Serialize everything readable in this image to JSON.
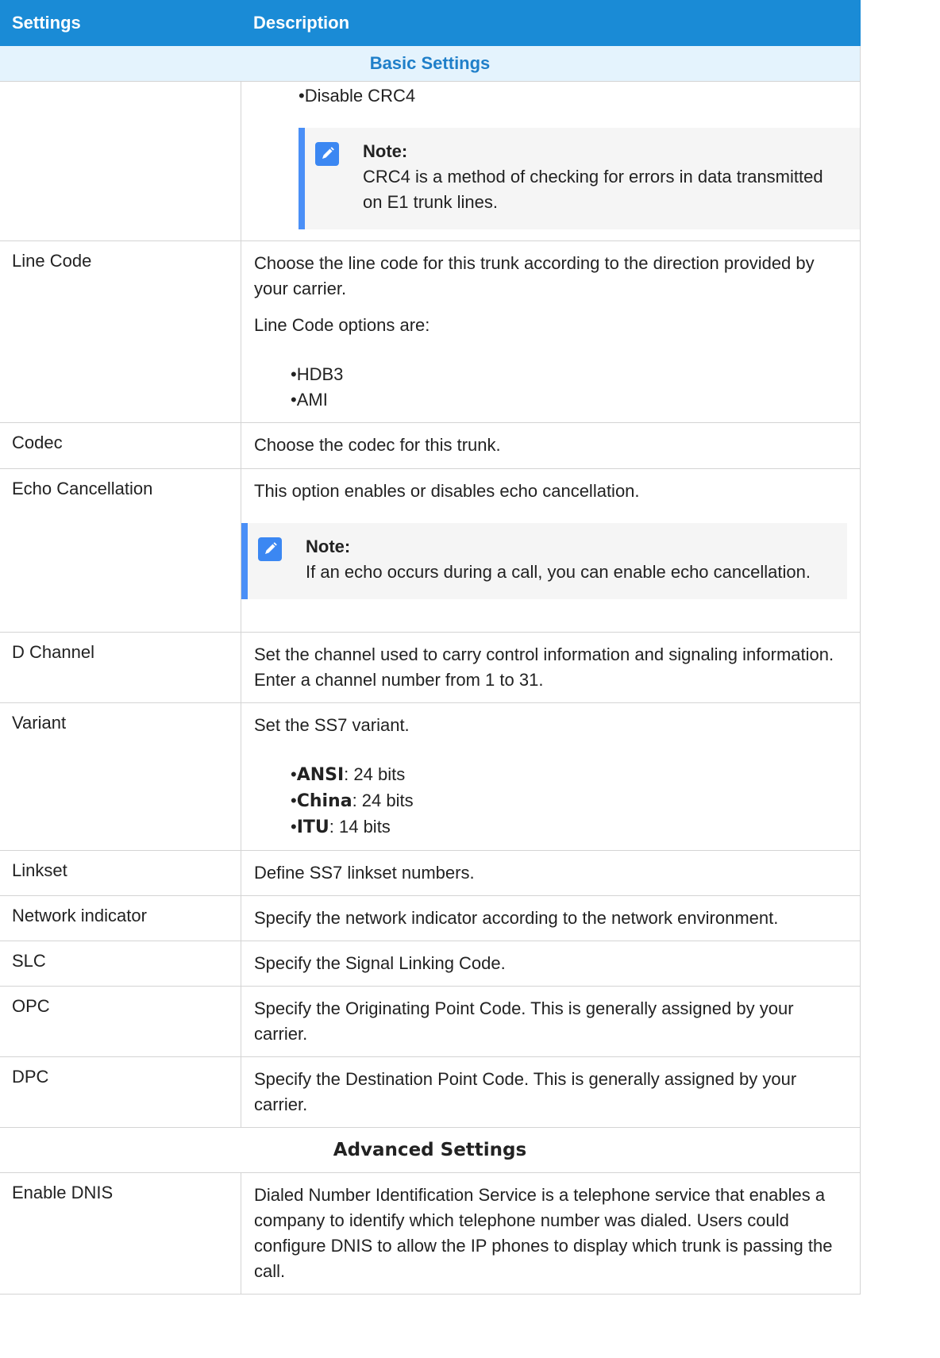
{
  "header": {
    "settings": "Settings",
    "description": "Description"
  },
  "sections": {
    "basic": "Basic Settings",
    "advanced": "Advanced Settings"
  },
  "crc": {
    "item": "Disable CRC4",
    "note_title": "Note:",
    "note_text": "CRC4 is a method of checking for errors in data transmitted on E1 trunk lines."
  },
  "line_code": {
    "name": "Line Code",
    "desc": "Choose the line code for this trunk according to the direction provided by your carrier.",
    "options_intro": "Line Code options are:",
    "options": [
      "HDB3",
      "AMI"
    ]
  },
  "codec": {
    "name": "Codec",
    "desc": "Choose the codec for this trunk."
  },
  "echo": {
    "name": "Echo Cancellation",
    "desc": "This option enables or disables echo cancellation.",
    "note_title": "Note:",
    "note_text": "If an echo occurs during a call, you can enable echo cancellation."
  },
  "d_channel": {
    "name": "D Channel",
    "desc": "Set the channel used to carry control information and signaling information. Enter a channel number from 1 to 31."
  },
  "variant": {
    "name": "Variant",
    "desc": "Set the SS7 variant.",
    "items": [
      {
        "key": "ANSI",
        "value": ": 24 bits"
      },
      {
        "key": "China",
        "value": ": 24 bits"
      },
      {
        "key": "ITU",
        "value": ": 14 bits"
      }
    ]
  },
  "linkset": {
    "name": "Linkset",
    "desc": "Define SS7 linkset numbers."
  },
  "network_indicator": {
    "name": "Network indicator",
    "desc": "Specify the network indicator according to the network environment."
  },
  "slc": {
    "name": "SLC",
    "desc": "Specify the Signal Linking Code."
  },
  "opc": {
    "name": "OPC",
    "desc": "Specify the Originating Point Code. This is generally assigned by your carrier."
  },
  "dpc": {
    "name": "DPC",
    "desc": "Specify the Destination Point Code. This is generally assigned by your carrier."
  },
  "dnis": {
    "name": "Enable DNIS",
    "desc": "Dialed Number Identification Service is a telephone service that enables a company to identify which telephone number was dialed. Users could configure DNIS to allow the IP phones to display which trunk is passing the call."
  },
  "colors": {
    "header": "#1a8bd6",
    "note_bar": "#4a8ff7",
    "section_bg": "#e4f3fd"
  },
  "icons": {
    "note": "note-edit-icon"
  }
}
